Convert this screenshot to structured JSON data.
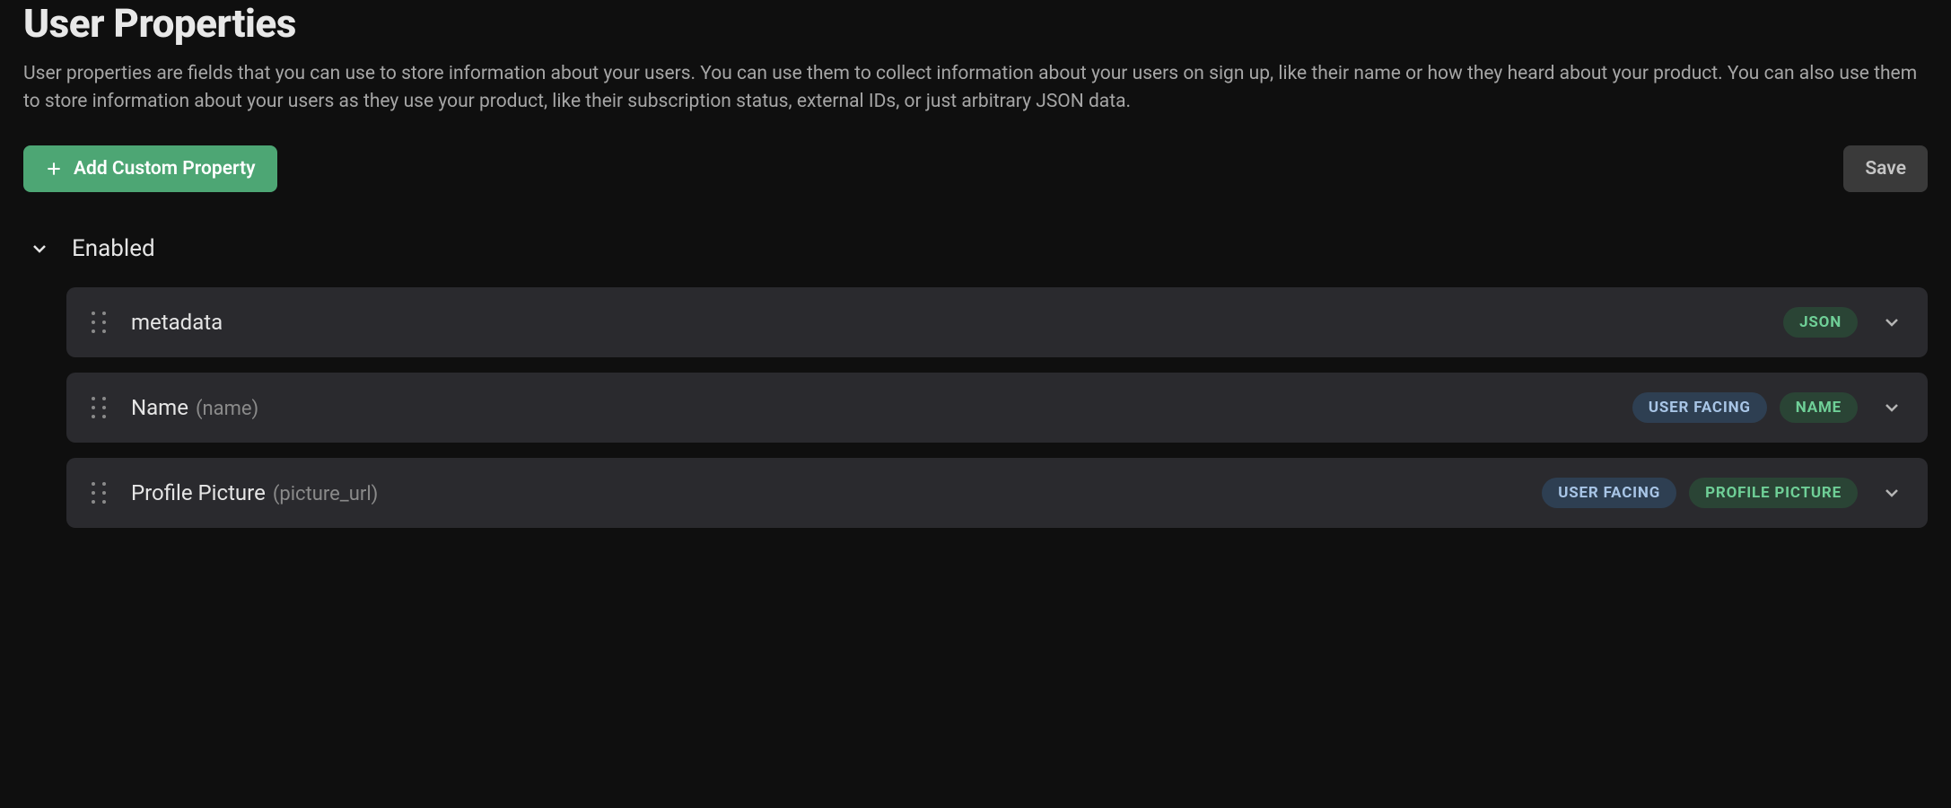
{
  "header": {
    "title": "User Properties",
    "description": "User properties are fields that you can use to store information about your users. You can use them to collect information about your users on sign up, like their name or how they heard about your product. You can also use them to store information about your users as they use your product, like their subscription status, external IDs, or just arbitrary JSON data."
  },
  "toolbar": {
    "add_label": "Add Custom Property",
    "save_label": "Save"
  },
  "section": {
    "title": "Enabled"
  },
  "properties": [
    {
      "label": "metadata",
      "sublabel": "",
      "badges": [
        {
          "text": "JSON",
          "kind": "green"
        }
      ]
    },
    {
      "label": "Name",
      "sublabel": "(name)",
      "badges": [
        {
          "text": "USER FACING",
          "kind": "blue"
        },
        {
          "text": "NAME",
          "kind": "green"
        }
      ]
    },
    {
      "label": "Profile Picture",
      "sublabel": "(picture_url)",
      "badges": [
        {
          "text": "USER FACING",
          "kind": "blue"
        },
        {
          "text": "PROFILE PICTURE",
          "kind": "green"
        }
      ]
    }
  ]
}
